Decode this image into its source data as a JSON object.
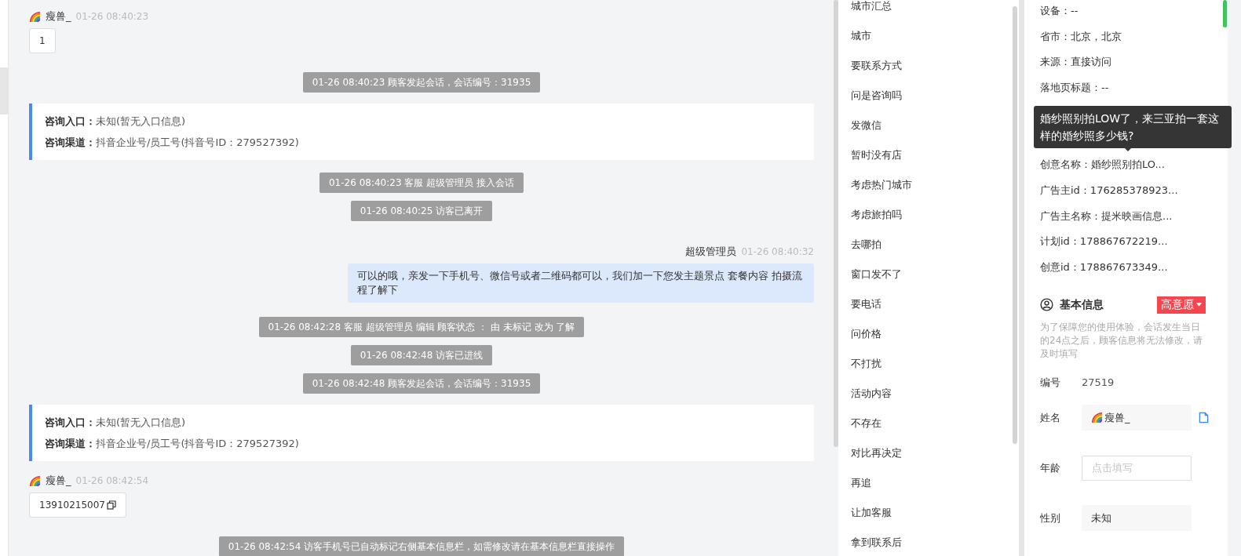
{
  "chat": {
    "messages": [
      {
        "kind": "visitor",
        "name": "瘦兽_",
        "time": "01-26 08:40:23",
        "content": "1",
        "copyable": false
      },
      {
        "kind": "system",
        "text": "01-26 08:40:23 顾客发起会话，会话编号：31935"
      },
      {
        "kind": "entry",
        "rows": [
          {
            "label": "咨询入口：",
            "value": "未知(暂无入口信息)"
          },
          {
            "label": "咨询渠道：",
            "value": "抖音企业号/员工号(抖音号ID：279527392)"
          }
        ]
      },
      {
        "kind": "system",
        "text": "01-26 08:40:23 客服 超级管理员 接入会话"
      },
      {
        "kind": "system",
        "text": "01-26 08:40:25 访客已离开"
      },
      {
        "kind": "agent",
        "name": "超级管理员",
        "time": "01-26 08:40:32",
        "content": "可以的哦，亲发一下手机号、微信号或者二维码都可以，我们加一下您发主题景点 套餐内容 拍摄流程了解下"
      },
      {
        "kind": "system",
        "text": "01-26 08:42:28 客服 超级管理员 编辑 顾客状态 ： 由 未标记 改为 了解"
      },
      {
        "kind": "system",
        "text": "01-26 08:42:48 访客已进线"
      },
      {
        "kind": "system",
        "text": "01-26 08:42:48 顾客发起会话，会话编号：31935"
      },
      {
        "kind": "entry",
        "rows": [
          {
            "label": "咨询入口：",
            "value": "未知(暂无入口信息)"
          },
          {
            "label": "咨询渠道：",
            "value": "抖音企业号/员工号(抖音号ID：279527392)"
          }
        ]
      },
      {
        "kind": "visitor",
        "name": "瘦兽_",
        "time": "01-26 08:42:54",
        "content": "13910215007",
        "copyable": true
      },
      {
        "kind": "system",
        "text": "01-26 08:42:54 访客手机号已自动标记右侧基本信息栏，如需修改请在基本信息栏直接操作"
      }
    ]
  },
  "quick_replies": [
    "城市汇总",
    "城市",
    "要联系方式",
    "问是咨询吗",
    "发微信",
    "暂时没有店",
    "考虑热门城市",
    "考虑旅拍吗",
    "去哪拍",
    "窗口发不了",
    "要电话",
    "问价格",
    "不打扰",
    "活动内容",
    "不存在",
    "对比再决定",
    "再追",
    "让加客服",
    "拿到联系后"
  ],
  "details": {
    "rows": [
      {
        "kind": "text",
        "text": "设备：--"
      },
      {
        "kind": "text",
        "text": "省市：北京，北京"
      },
      {
        "kind": "text",
        "text": "来源：直接访问"
      },
      {
        "kind": "text",
        "text": "落地页标题：--"
      },
      {
        "kind": "hidden"
      },
      {
        "kind": "hidden"
      },
      {
        "kind": "text",
        "text": "创意名称：婚纱照别拍LO..."
      },
      {
        "kind": "text",
        "text": "广告主id：176285378923..."
      },
      {
        "kind": "text",
        "text": "广告主名称：提米映画信息..."
      },
      {
        "kind": "text",
        "text": "计划id：178867672219..."
      },
      {
        "kind": "text",
        "text": "创意id：178867673349..."
      }
    ],
    "tooltip": "婚纱照别拍LOW了，来三亚拍一套这样的婚纱照多少钱?"
  },
  "basic_info": {
    "title": "基本信息",
    "intent": "高意愿",
    "note": "为了保障您的使用体验，会话发生当日的24点之后，顾客信息将无法修改，请及时填写",
    "fields": [
      {
        "kind": "plain",
        "label": "编号",
        "value": "27519"
      },
      {
        "kind": "filled",
        "label": "姓名",
        "value": "瘦兽_",
        "avatar": true,
        "copyable": true
      },
      {
        "kind": "input",
        "label": "年龄",
        "placeholder": "点击填写"
      },
      {
        "kind": "filled",
        "label": "性别",
        "value": "未知",
        "avatar": false,
        "copyable": false
      }
    ]
  }
}
